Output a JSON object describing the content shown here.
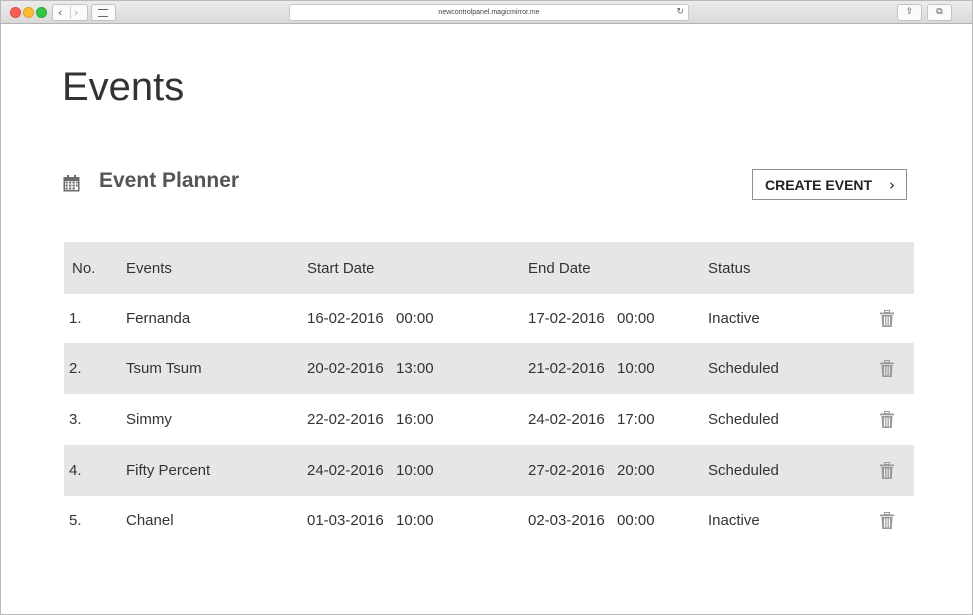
{
  "browser": {
    "url": "newcontrolpanel.magicmirror.me"
  },
  "page": {
    "title": "Events",
    "section_title": "Event Planner",
    "create_button_label": "CREATE EVENT"
  },
  "table": {
    "headers": {
      "no": "No.",
      "events": "Events",
      "start_date": "Start Date",
      "end_date": "End Date",
      "status": "Status"
    },
    "rows": [
      {
        "no": "1.",
        "event": "Fernanda",
        "start_date": "16-02-2016",
        "start_time": "00:00",
        "end_date": "17-02-2016",
        "end_time": "00:00",
        "status": "Inactive"
      },
      {
        "no": "2.",
        "event": "Tsum Tsum",
        "start_date": "20-02-2016",
        "start_time": "13:00",
        "end_date": "21-02-2016",
        "end_time": "10:00",
        "status": "Scheduled"
      },
      {
        "no": "3.",
        "event": "Simmy",
        "start_date": "22-02-2016",
        "start_time": "16:00",
        "end_date": "24-02-2016",
        "end_time": "17:00",
        "status": "Scheduled"
      },
      {
        "no": "4.",
        "event": "Fifty Percent",
        "start_date": "24-02-2016",
        "start_time": "10:00",
        "end_date": "27-02-2016",
        "end_time": "20:00",
        "status": "Scheduled"
      },
      {
        "no": "5.",
        "event": "Chanel",
        "start_date": "01-03-2016",
        "start_time": "10:00",
        "end_date": "02-03-2016",
        "end_time": "00:00",
        "status": "Inactive"
      }
    ]
  },
  "icons": {
    "section": "calendar-icon",
    "row_action": "trash-icon"
  },
  "colors": {
    "header_bg": "#e6e6e6",
    "stripe_bg": "#e6e6e6",
    "text": "#333333",
    "icon_gray": "#9a9a9a"
  }
}
